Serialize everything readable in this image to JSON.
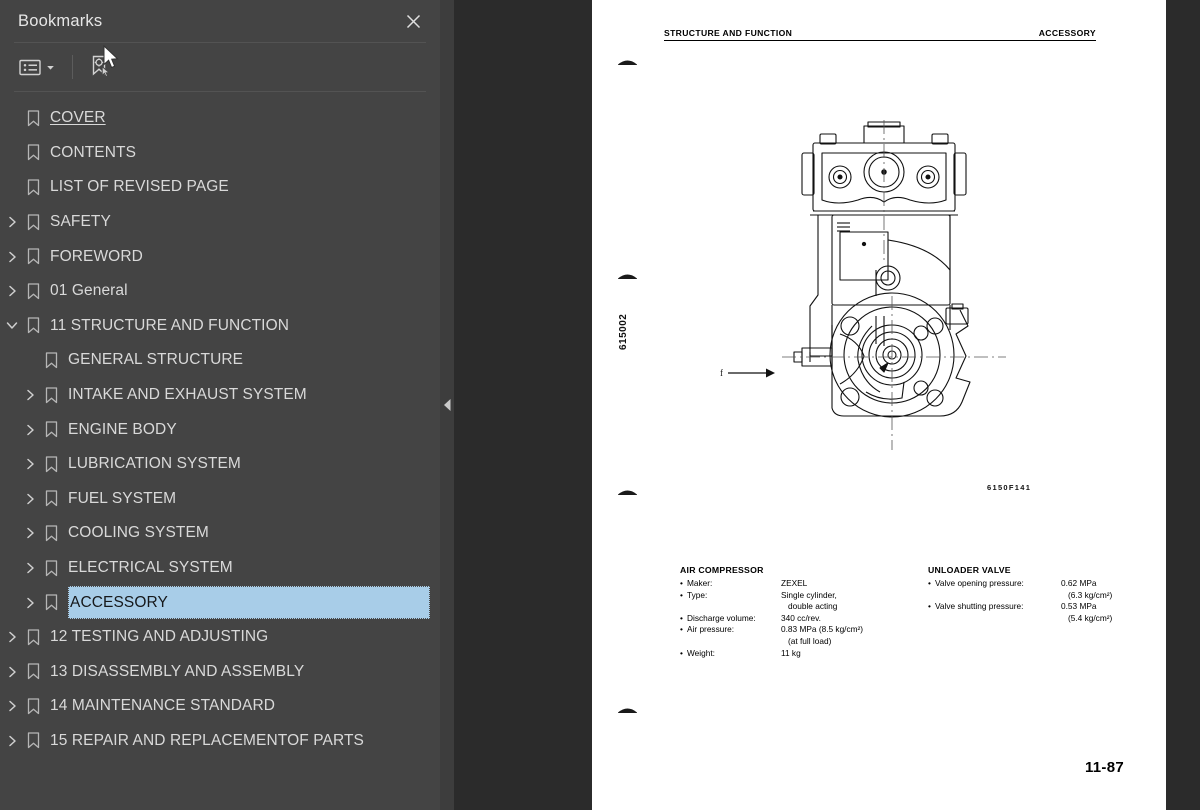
{
  "panel": {
    "title": "Bookmarks",
    "close_icon": "close-icon",
    "toolbar": {
      "options_label": "options-list-icon",
      "options_caret": "chevron-down-icon",
      "current_bookmark_label": "current-bookmark-icon"
    }
  },
  "bookmarks": [
    {
      "label": "COVER",
      "depth": 0,
      "twisty": "none",
      "state": "underline"
    },
    {
      "label": "CONTENTS",
      "depth": 0,
      "twisty": "none",
      "state": "normal"
    },
    {
      "label": "LIST OF REVISED PAGE",
      "depth": 0,
      "twisty": "none",
      "state": "normal"
    },
    {
      "label": "SAFETY",
      "depth": 0,
      "twisty": "collapsed",
      "state": "normal"
    },
    {
      "label": "FOREWORD",
      "depth": 0,
      "twisty": "collapsed",
      "state": "normal"
    },
    {
      "label": "01 General",
      "depth": 0,
      "twisty": "collapsed",
      "state": "normal"
    },
    {
      "label": "11 STRUCTURE AND FUNCTION",
      "depth": 0,
      "twisty": "expanded",
      "state": "normal"
    },
    {
      "label": "GENERAL STRUCTURE",
      "depth": 1,
      "twisty": "none",
      "state": "normal"
    },
    {
      "label": "INTAKE AND EXHAUST SYSTEM",
      "depth": 1,
      "twisty": "collapsed",
      "state": "normal"
    },
    {
      "label": "ENGINE BODY",
      "depth": 1,
      "twisty": "collapsed",
      "state": "normal"
    },
    {
      "label": "LUBRICATION SYSTEM",
      "depth": 1,
      "twisty": "collapsed",
      "state": "normal"
    },
    {
      "label": "FUEL SYSTEM",
      "depth": 1,
      "twisty": "collapsed",
      "state": "normal"
    },
    {
      "label": "COOLING SYSTEM",
      "depth": 1,
      "twisty": "collapsed",
      "state": "normal"
    },
    {
      "label": "ELECTRICAL SYSTEM",
      "depth": 1,
      "twisty": "collapsed",
      "state": "normal"
    },
    {
      "label": "ACCESSORY",
      "depth": 1,
      "twisty": "collapsed",
      "state": "selected"
    },
    {
      "label": "12 TESTING AND ADJUSTING",
      "depth": 0,
      "twisty": "collapsed",
      "state": "normal"
    },
    {
      "label": "13 DISASSEMBLY AND ASSEMBLY",
      "depth": 0,
      "twisty": "collapsed",
      "state": "normal"
    },
    {
      "label": "14 MAINTENANCE STANDARD",
      "depth": 0,
      "twisty": "collapsed",
      "state": "normal"
    },
    {
      "label": "15 REPAIR AND REPLACEMENTOF PARTS",
      "depth": 0,
      "twisty": "collapsed",
      "state": "normal"
    }
  ],
  "splitter": {
    "icon": "collapse-left-triangle-icon"
  },
  "document": {
    "header_left": "STRUCTURE AND FUNCTION",
    "header_right": "ACCESSORY",
    "vertical_code": "615002",
    "figure_code": "6150F141",
    "page_number": "11-87",
    "spec_left": {
      "title": "AIR COMPRESSOR",
      "rows": [
        {
          "key": "Maker:",
          "value": "ZEXEL"
        },
        {
          "key": "Type:",
          "value": "Single cylinder,"
        },
        {
          "key": "",
          "value": "double acting"
        },
        {
          "key": "Discharge volume:",
          "value": "340 cc/rev."
        },
        {
          "key": "Air pressure:",
          "value": "0.83 MPa (8.5 kg/cm²)"
        },
        {
          "key": "",
          "value": "(at full load)"
        },
        {
          "key": "Weight:",
          "value": "11 kg"
        }
      ]
    },
    "spec_right": {
      "title": "UNLOADER VALVE",
      "rows": [
        {
          "key": "Valve opening pressure:",
          "value": "0.62 MPa"
        },
        {
          "key": "",
          "value": "(6.3 kg/cm²)"
        },
        {
          "key": "Valve shutting pressure:",
          "value": "0.53 MPa"
        },
        {
          "key": "",
          "value": "(5.4 kg/cm²)"
        }
      ]
    }
  },
  "colors": {
    "panel_bg": "#444444",
    "viewer_bg": "#2b2b2b",
    "selection": "#a8cde8",
    "text": "#d9d9d9"
  }
}
